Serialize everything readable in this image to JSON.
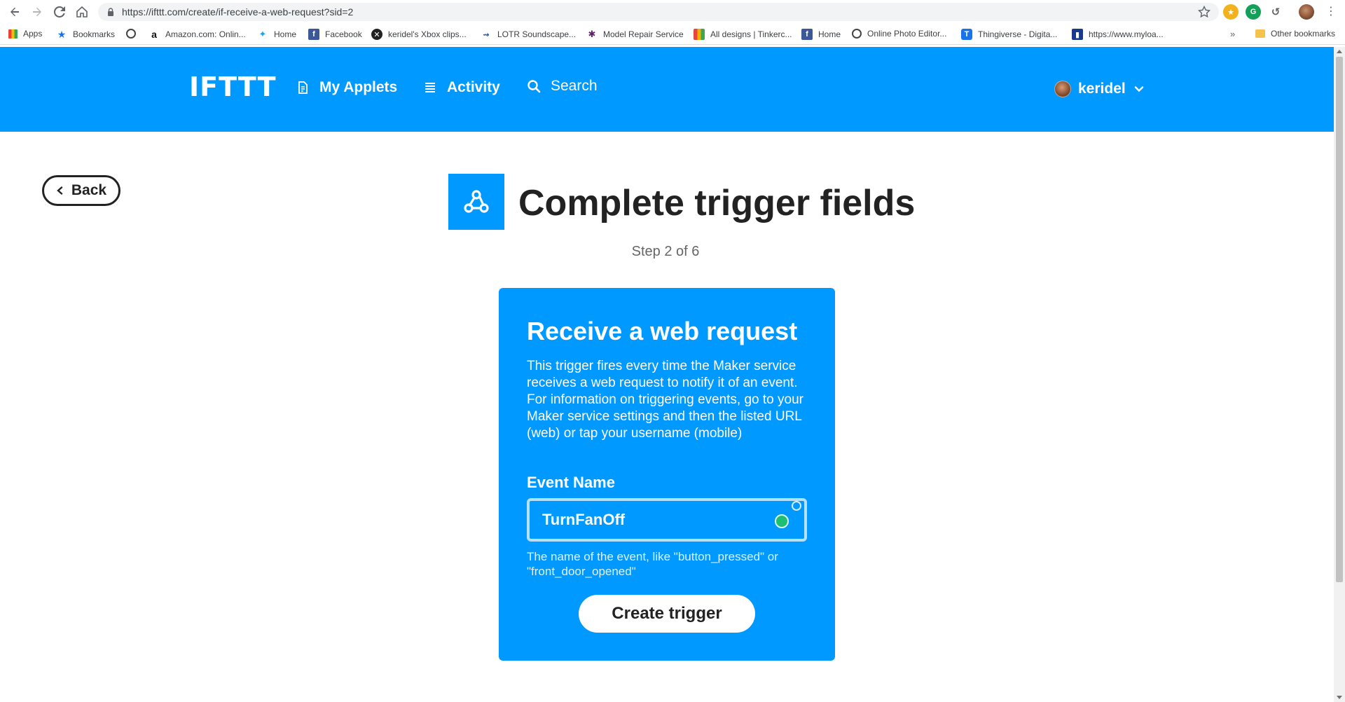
{
  "browser": {
    "url": "https://ifttt.com/create/if-receive-a-web-request?sid=2",
    "bookmarks": [
      {
        "label": "Apps",
        "icon": "apps-grid-icon"
      },
      {
        "label": "Bookmarks",
        "icon": "star-icon"
      },
      {
        "label": "",
        "icon": "globe-icon"
      },
      {
        "label": "Amazon.com: Onlin...",
        "icon": "amazon-icon"
      },
      {
        "label": "Home",
        "icon": "twitter-icon"
      },
      {
        "label": "Facebook",
        "icon": "facebook-icon"
      },
      {
        "label": "keridel's Xbox clips...",
        "icon": "xbox-icon"
      },
      {
        "label": "LOTR Soundscape...",
        "icon": "soundscape-icon"
      },
      {
        "label": "Model Repair Service",
        "icon": "slack-icon"
      },
      {
        "label": "All designs | Tinkerc...",
        "icon": "tinkercad-icon"
      },
      {
        "label": "Home",
        "icon": "facebook-icon"
      },
      {
        "label": "Online Photo Editor...",
        "icon": "photo-editor-icon"
      },
      {
        "label": "Thingiverse - Digita...",
        "icon": "thingiverse-icon"
      },
      {
        "label": "https://www.myloa...",
        "icon": "myloan-icon"
      }
    ],
    "more_label": "»",
    "other_bookmarks": "Other bookmarks"
  },
  "header": {
    "logo": "IFTTT",
    "nav": {
      "my_applets": "My Applets",
      "activity": "Activity",
      "search": "Search"
    },
    "username": "keridel"
  },
  "main": {
    "back_label": "Back",
    "title": "Complete trigger fields",
    "step": "Step 2 of 6",
    "service_icon": "webhooks-icon",
    "card": {
      "title": "Receive a web request",
      "description": "This trigger fires every time the Maker service receives a web request to notify it of an event. For information on triggering events, go to your Maker service settings and then the listed URL (web) or tap your username (mobile)",
      "field_label": "Event Name",
      "field_value": "TurnFanOff",
      "field_help": "The name of the event, like \"button_pressed\" or \"front_door_opened\"",
      "submit_label": "Create trigger"
    }
  },
  "colors": {
    "brand_blue": "#0099ff",
    "text_dark": "#222222"
  }
}
